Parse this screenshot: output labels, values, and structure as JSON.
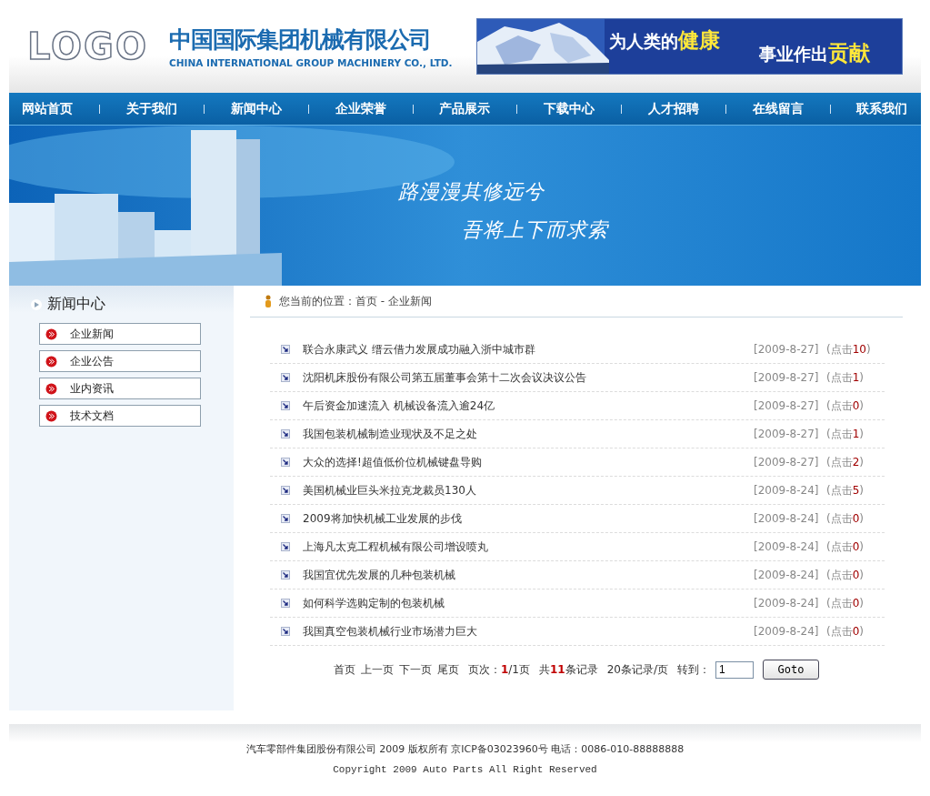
{
  "header": {
    "logo": "LOGO",
    "company_name": "中国国际集团机械有限公司",
    "company_name_en": "CHINA INTERNATIONAL GROUP MACHINERY CO., LTD.",
    "ad": {
      "kind": "picture",
      "lines": [
        "为人类的**健康**",
        "事业作出**贡献**"
      ]
    }
  },
  "nav": [
    {
      "label": "网站首页"
    },
    {
      "label": "关于我们"
    },
    {
      "label": "新闻中心"
    },
    {
      "label": "企业荣誉"
    },
    {
      "label": "产品展示"
    },
    {
      "label": "下载中心"
    },
    {
      "label": "人才招聘"
    },
    {
      "label": "在线留言"
    },
    {
      "label": "联系我们"
    }
  ],
  "banner": {
    "kind": "picture",
    "lines": [
      "路漫漫其修远兮",
      "吾将上下而求索"
    ]
  },
  "sidebar": {
    "title": "新闻中心",
    "items": [
      {
        "label": "企业新闻"
      },
      {
        "label": "企业公告"
      },
      {
        "label": "业内资讯"
      },
      {
        "label": "技术文档"
      }
    ]
  },
  "breadcrumb": "您当前的位置：首页 - 企业新闻",
  "news": [
    {
      "title": "联合永康武义 缙云借力发展成功融入浙中城市群",
      "date": "[2009-8-27]",
      "views": "(点击**10**)"
    },
    {
      "title": "沈阳机床股份有限公司第五届董事会第十二次会议决议公告",
      "date": "[2009-8-27]",
      "views": "(点击**1**)"
    },
    {
      "title": "午后资金加速流入 机械设备流入逾24亿",
      "date": "[2009-8-27]",
      "views": "(点击**0**)"
    },
    {
      "title": "我国包装机械制造业现状及不足之处",
      "date": "[2009-8-27]",
      "views": "(点击**1**)"
    },
    {
      "title": "大众的选择!超值低价位机械键盘导购",
      "date": "[2009-8-27]",
      "views": "(点击**2**)"
    },
    {
      "title": "美国机械业巨头米拉克龙裁员130人",
      "date": "[2009-8-24]",
      "views": "(点击**5**)"
    },
    {
      "title": "2009将加快机械工业发展的步伐",
      "date": "[2009-8-24]",
      "views": "(点击**0**)"
    },
    {
      "title": "上海凡太克工程机械有限公司增设喷丸",
      "date": "[2009-8-24]",
      "views": "(点击**0**)"
    },
    {
      "title": "我国宜优先发展的几种包装机械",
      "date": "[2009-8-24]",
      "views": "(点击**0**)"
    },
    {
      "title": "如何科学选购定制的包装机械",
      "date": "[2009-8-24]",
      "views": "(点击**0**)"
    },
    {
      "title": "我国真空包装机械行业市场潜力巨大",
      "date": "[2009-8-24]",
      "views": "(点击**0**)"
    }
  ],
  "pagination": {
    "parts": [
      {
        "kind": "link",
        "text": "首页"
      },
      {
        "kind": "link",
        "text": "上一页"
      },
      {
        "kind": "link",
        "text": "下一页"
      },
      {
        "kind": "link",
        "text": "尾页"
      },
      {
        "kind": "info",
        "text": "页次：**1**/1页"
      },
      {
        "kind": "info",
        "text": "共**11**条记录"
      },
      {
        "kind": "info",
        "text": "20条记录/页"
      },
      {
        "kind": "info",
        "text": "转到："
      }
    ],
    "page_input": "1",
    "button": "Goto"
  },
  "footer": {
    "lines": [
      "汽车零部件集团股份有限公司 2009 版权所有 京ICP备03023960号 电话：0086-010-88888888",
      "Copyright 2009 Auto Parts All Right Reserved"
    ]
  }
}
